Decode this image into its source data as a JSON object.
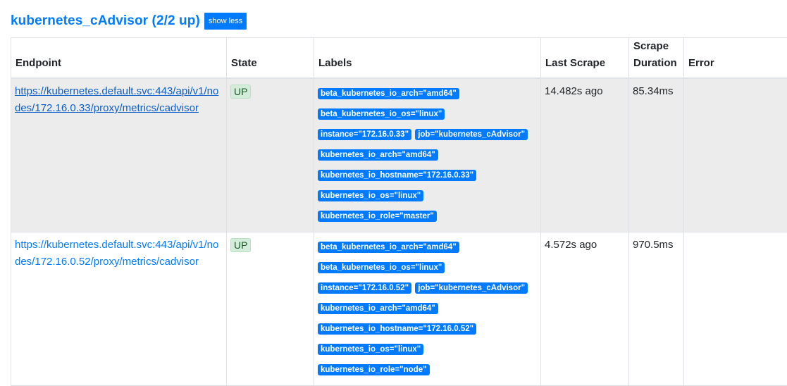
{
  "pool": {
    "title": "kubernetes_cAdvisor (2/2 up)",
    "toggle_label": "show less"
  },
  "table": {
    "headers": {
      "endpoint": "Endpoint",
      "state": "State",
      "labels": "Labels",
      "last_scrape": "Last Scrape",
      "scrape_duration_line1": "Scrape",
      "scrape_duration_line2": "Duration",
      "error": "Error"
    },
    "rows": [
      {
        "endpoint": "https://kubernetes.default.svc:443/api/v1/nodes/172.16.0.33/proxy/metrics/cadvisor",
        "state": "UP",
        "labels": [
          "beta_kubernetes_io_arch=\"amd64\"",
          "beta_kubernetes_io_os=\"linux\"",
          "instance=\"172.16.0.33\"",
          "job=\"kubernetes_cAdvisor\"",
          "kubernetes_io_arch=\"amd64\"",
          "kubernetes_io_hostname=\"172.16.0.33\"",
          "kubernetes_io_os=\"linux\"",
          "kubernetes_io_role=\"master\""
        ],
        "last_scrape": "14.482s ago",
        "scrape_duration": "85.34ms",
        "error": ""
      },
      {
        "endpoint": "https://kubernetes.default.svc:443/api/v1/nodes/172.16.0.52/proxy/metrics/cadvisor",
        "state": "UP",
        "labels": [
          "beta_kubernetes_io_arch=\"amd64\"",
          "beta_kubernetes_io_os=\"linux\"",
          "instance=\"172.16.0.52\"",
          "job=\"kubernetes_cAdvisor\"",
          "kubernetes_io_arch=\"amd64\"",
          "kubernetes_io_hostname=\"172.16.0.52\"",
          "kubernetes_io_os=\"linux\"",
          "kubernetes_io_role=\"node\""
        ],
        "last_scrape": "4.572s ago",
        "scrape_duration": "970.5ms",
        "error": ""
      }
    ]
  }
}
